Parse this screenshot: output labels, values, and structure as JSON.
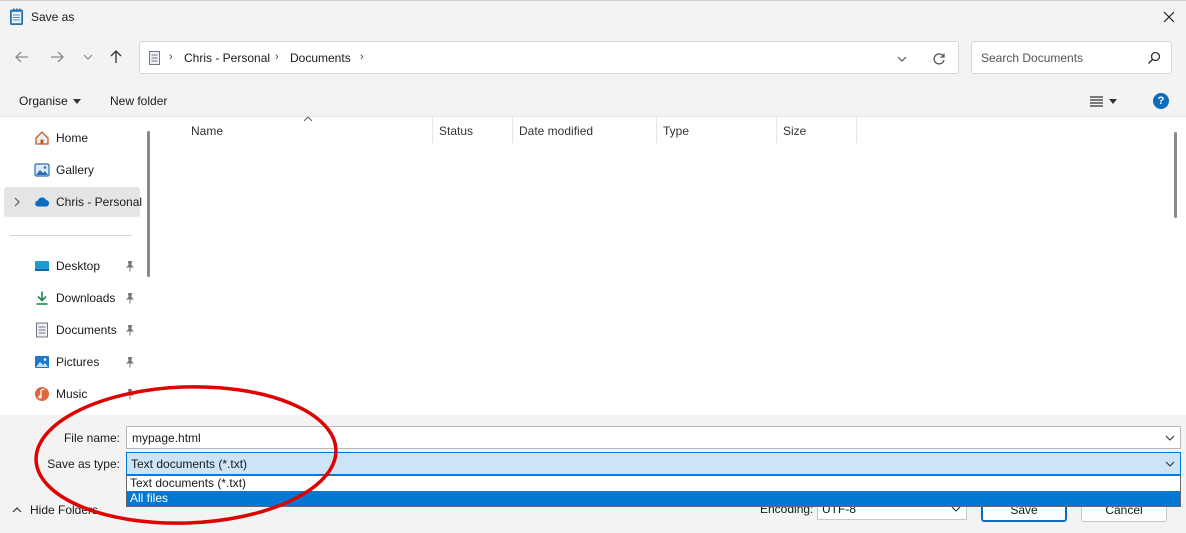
{
  "window": {
    "title": "Save as",
    "title_icon": "notepad-icon",
    "close_icon": "close-icon"
  },
  "navigation": {
    "back_icon": "back-arrow-icon",
    "forward_icon": "forward-arrow-icon",
    "recent_icon": "chevron-down-icon",
    "up_icon": "up-arrow-icon",
    "breadcrumb": [
      "Chris - Personal",
      "Documents"
    ],
    "refresh_icon": "refresh-icon",
    "search_placeholder": "Search Documents"
  },
  "toolbar": {
    "organise_label": "Organise",
    "new_folder_label": "New folder",
    "view_icon": "list-view-icon",
    "help_icon": "?"
  },
  "sidebar": {
    "items": [
      {
        "label": "Home",
        "icon": "home-icon",
        "pinned": false
      },
      {
        "label": "Gallery",
        "icon": "gallery-icon",
        "pinned": false
      },
      {
        "label": "Chris - Personal",
        "icon": "onedrive-cloud-icon",
        "pinned": false,
        "selected": true
      },
      {
        "label": "Desktop",
        "icon": "desktop-icon",
        "pinned": true
      },
      {
        "label": "Downloads",
        "icon": "download-icon",
        "pinned": true
      },
      {
        "label": "Documents",
        "icon": "document-icon",
        "pinned": true
      },
      {
        "label": "Pictures",
        "icon": "pictures-icon",
        "pinned": true
      },
      {
        "label": "Music",
        "icon": "music-icon",
        "pinned": true
      }
    ]
  },
  "file_list": {
    "columns": [
      "Name",
      "Status",
      "Date modified",
      "Type",
      "Size"
    ],
    "rows": []
  },
  "form": {
    "file_name_label": "File name:",
    "file_name_value": "mypage.html",
    "save_as_type_label": "Save as type:",
    "save_as_type_value": "Text documents (*.txt)",
    "save_as_type_options": [
      "Text documents (*.txt)",
      "All files"
    ],
    "highlighted_option": "All files"
  },
  "footer": {
    "hide_folders_label": "Hide Folders",
    "encoding_label": "Encoding:",
    "encoding_value": "UTF-8",
    "save_label": "Save",
    "cancel_label": "Cancel"
  },
  "colors": {
    "accent": "#0078d4",
    "annotation": "#e00000",
    "selection_bg": "#cce4f7"
  }
}
